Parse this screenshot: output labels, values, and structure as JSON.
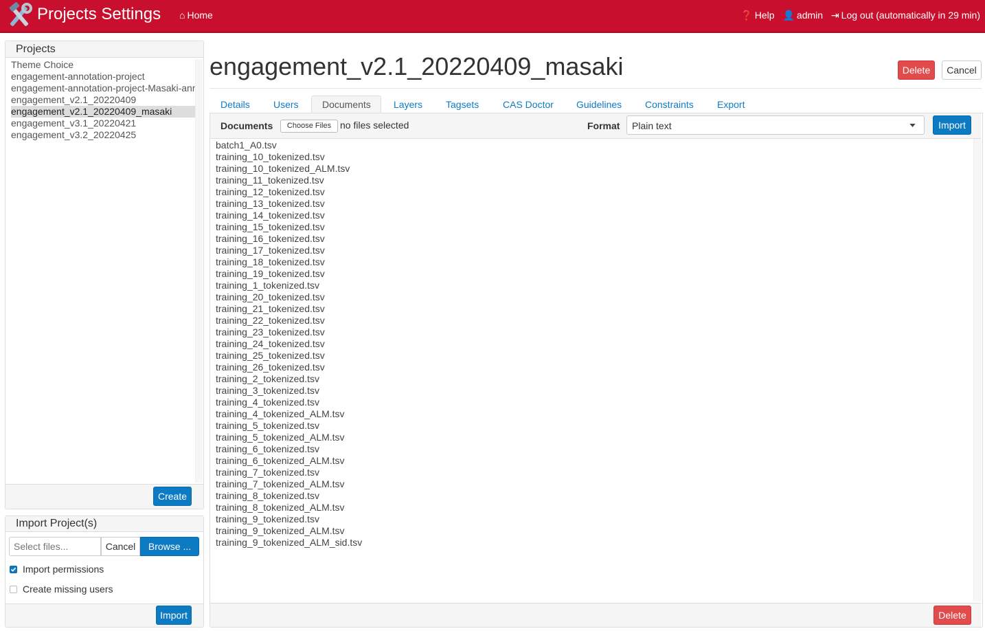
{
  "header": {
    "title": "Projects Settings",
    "home": "Home",
    "help": "Help",
    "user": "admin",
    "logout": "Log out (automatically in 29 min)"
  },
  "projects_panel": {
    "title": "Projects",
    "items": [
      "Theme Choice",
      "engagement-annotation-project",
      "engagement-annotation-project-Masaki-annotation",
      "engagement_v2.1_20220409",
      "engagement_v2.1_20220409_masaki",
      "engagement_v3.1_20220421",
      "engagement_v3.2_20220425"
    ],
    "selected_index": 4,
    "create_label": "Create"
  },
  "import_panel": {
    "title": "Import Project(s)",
    "file_placeholder": "Select files...",
    "cancel_label": "Cancel",
    "browse_label": "Browse ...",
    "import_permissions_label": "Import permissions",
    "import_permissions_checked": true,
    "create_missing_users_label": "Create missing users",
    "create_missing_users_checked": false,
    "import_label": "Import"
  },
  "project": {
    "name": "engagement_v2.1_20220409_masaki",
    "delete_label": "Delete",
    "cancel_label": "Cancel"
  },
  "tabs": [
    {
      "label": "Details"
    },
    {
      "label": "Users"
    },
    {
      "label": "Documents",
      "active": true
    },
    {
      "label": "Layers"
    },
    {
      "label": "Tagsets"
    },
    {
      "label": "CAS Doctor"
    },
    {
      "label": "Guidelines"
    },
    {
      "label": "Constraints"
    },
    {
      "label": "Export"
    }
  ],
  "documents": {
    "label": "Documents",
    "choose_files_label": "Choose Files",
    "no_files_text": "no files selected",
    "format_label": "Format",
    "format_value": "Plain text",
    "import_label": "Import",
    "delete_label": "Delete",
    "files": [
      "batch1_A0.tsv",
      "training_10_tokenized.tsv",
      "training_10_tokenized_ALM.tsv",
      "training_11_tokenized.tsv",
      "training_12_tokenized.tsv",
      "training_13_tokenized.tsv",
      "training_14_tokenized.tsv",
      "training_15_tokenized.tsv",
      "training_16_tokenized.tsv",
      "training_17_tokenized.tsv",
      "training_18_tokenized.tsv",
      "training_19_tokenized.tsv",
      "training_1_tokenized.tsv",
      "training_20_tokenized.tsv",
      "training_21_tokenized.tsv",
      "training_22_tokenized.tsv",
      "training_23_tokenized.tsv",
      "training_24_tokenized.tsv",
      "training_25_tokenized.tsv",
      "training_26_tokenized.tsv",
      "training_2_tokenized.tsv",
      "training_3_tokenized.tsv",
      "training_4_tokenized.tsv",
      "training_4_tokenized_ALM.tsv",
      "training_5_tokenized.tsv",
      "training_5_tokenized_ALM.tsv",
      "training_6_tokenized.tsv",
      "training_6_tokenized_ALM.tsv",
      "training_7_tokenized.tsv",
      "training_7_tokenized_ALM.tsv",
      "training_8_tokenized.tsv",
      "training_8_tokenized_ALM.tsv",
      "training_9_tokenized.tsv",
      "training_9_tokenized_ALM.tsv",
      "training_9_tokenized_ALM_sid.tsv"
    ]
  },
  "colors": {
    "navbar": "#c8102e",
    "primary": "#0d7bc4",
    "danger": "#e14b4b"
  },
  "icons": {
    "brand": "tools-icon",
    "home": "home-icon",
    "help": "question-circle-icon",
    "user": "user-icon",
    "logout": "logout-icon",
    "select": "caret-down-icon"
  }
}
